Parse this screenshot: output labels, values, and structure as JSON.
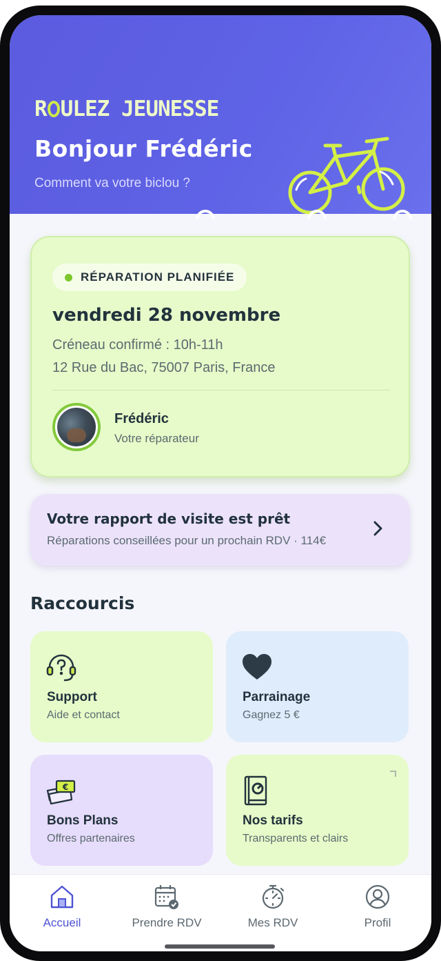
{
  "header": {
    "brand": "ROULEZ JEUNESSE",
    "brand_first": "R",
    "brand_rest": "ULEZ JEUNESSE",
    "greeting": "Bonjour Frédéric",
    "subtitle": "Comment va votre biclou ?"
  },
  "appointment": {
    "status": "RÉPARATION PLANIFIÉE",
    "date": "vendredi 28 novembre",
    "slot": "Créneau confirmé : 10h-11h",
    "address": "12 Rue du Bac, 75007 Paris, France",
    "repairer_name": "Frédéric",
    "repairer_role": "Votre réparateur"
  },
  "report": {
    "title": "Votre rapport de visite est prêt",
    "subtitle": "Réparations conseillées pour un prochain RDV · 114€"
  },
  "shortcuts": {
    "title": "Raccourcis",
    "items": [
      {
        "title": "Support",
        "subtitle": "Aide et contact",
        "icon": "headset-icon"
      },
      {
        "title": "Parrainage",
        "subtitle": "Gagnez 5 €",
        "icon": "heart-icon"
      },
      {
        "title": "Bons Plans",
        "subtitle": "Offres partenaires",
        "icon": "cash-icon"
      },
      {
        "title": "Nos tarifs",
        "subtitle": "Transparents et clairs",
        "icon": "book-icon"
      }
    ]
  },
  "tabbar": {
    "items": [
      {
        "label": "Accueil",
        "icon": "home-icon",
        "active": true
      },
      {
        "label": "Prendre RDV",
        "icon": "calendar-icon",
        "active": false
      },
      {
        "label": "Mes RDV",
        "icon": "stopwatch-icon",
        "active": false
      },
      {
        "label": "Profil",
        "icon": "user-icon",
        "active": false
      }
    ]
  },
  "colors": {
    "hero": "#5b5bdf",
    "accent_green": "#cfe94b",
    "card_green": "#e6fbc9",
    "card_purple": "#ece3fb",
    "active_tab": "#4e53d3"
  }
}
